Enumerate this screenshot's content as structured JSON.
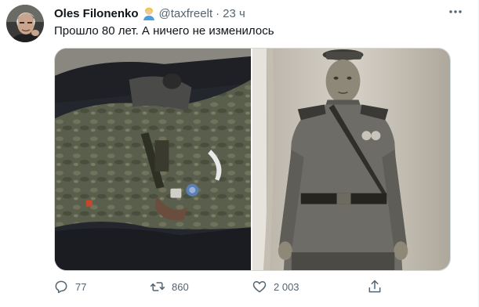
{
  "author": {
    "name": "Oles Filonenko",
    "emoji_icon": "person-blond-hair-emoji",
    "handle": "@taxfreelt",
    "separator": "·",
    "time": "23 ч"
  },
  "tweet": {
    "text": "Прошло 80 лет. А ничего не изменилось"
  },
  "media": {
    "left_photo_icon": "modern-soldier-photo",
    "right_photo_icon": "vintage-soldier-portrait-photo"
  },
  "actions": {
    "reply_count": "77",
    "retweet_count": "860",
    "like_count": "2 003"
  },
  "colors": {
    "text_primary": "#0f1419",
    "text_secondary": "#536471",
    "border": "#cfd9de"
  }
}
